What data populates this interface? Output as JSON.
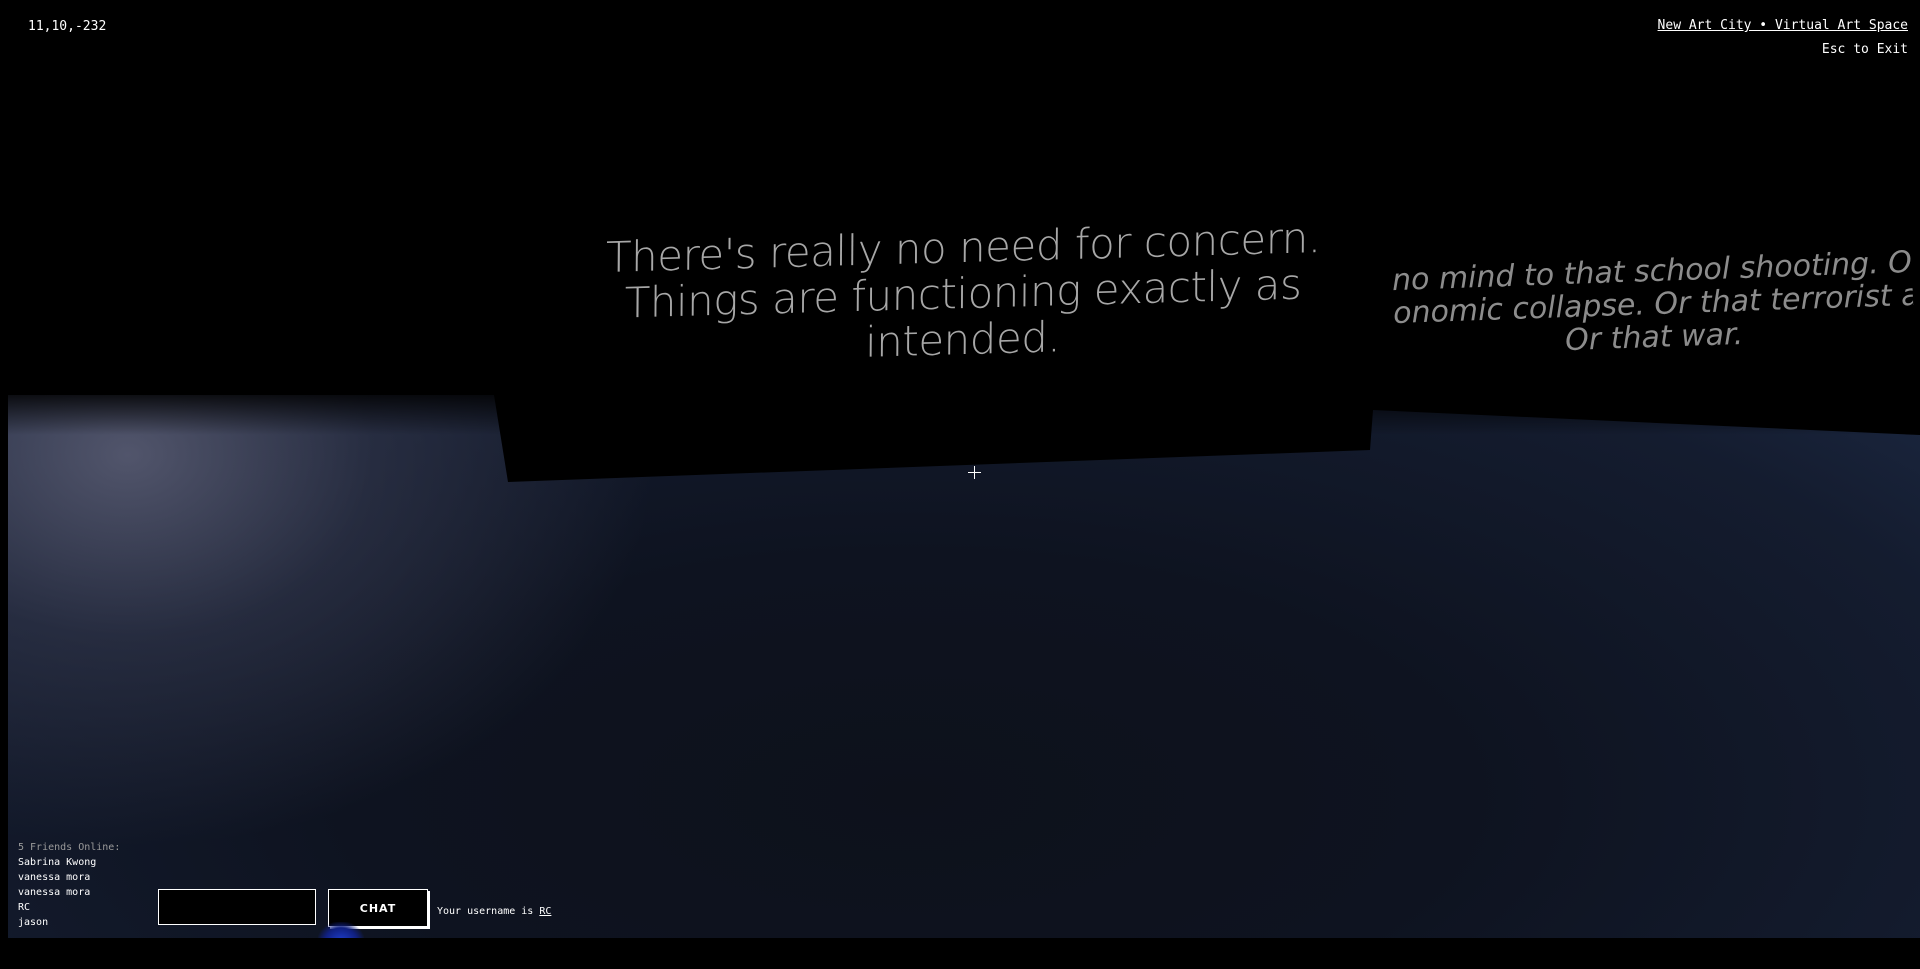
{
  "hud": {
    "coordinates": "11,10,-232",
    "title_link": "New Art City • Virtual Art Space",
    "exit_hint": "Esc to Exit"
  },
  "artwork": {
    "main_text": "There's really no need for concern. Things are functioning exactly as intended.",
    "side_text_line1": "no mind to that school shooting. O",
    "side_text_line2": "onomic collapse. Or that terrorist at",
    "side_text_line3": "Or that war."
  },
  "friends": {
    "header": "5 Friends Online:",
    "names": [
      "Sabrina Kwong",
      "vanessa mora",
      "vanessa mora",
      "RC",
      "jason"
    ]
  },
  "chat": {
    "input_value": "",
    "button_label": "CHAT",
    "username_prefix": "Your username is",
    "username": "RC"
  },
  "colors": {
    "background": "#000000",
    "floor": "#121a2b",
    "text": "#ffffff",
    "artwork_text": "#a7a7a7",
    "accent_blue": "#1e3fd0"
  }
}
